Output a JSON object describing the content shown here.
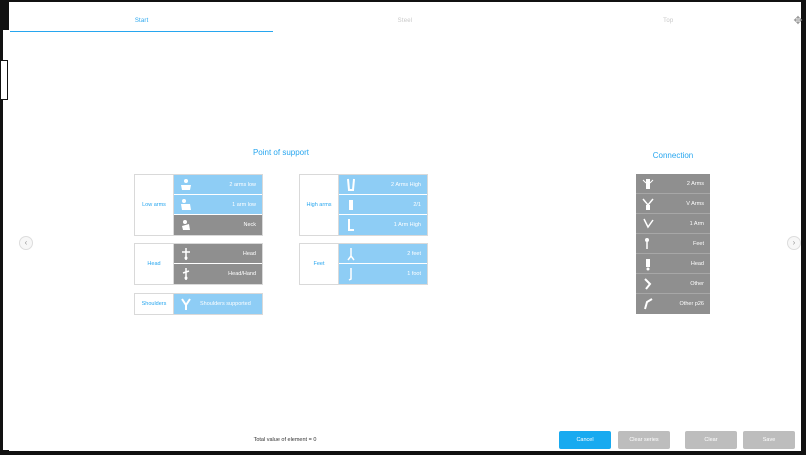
{
  "tabs": [
    {
      "label": "Start",
      "active": true
    },
    {
      "label": "Steel",
      "active": false
    },
    {
      "label": "Top",
      "active": false
    }
  ],
  "point_of_support": {
    "title": "Point of support",
    "groups": {
      "low_arms": {
        "label": "Low arms",
        "items": [
          "2 arms low",
          "1 arm low",
          "Neck"
        ]
      },
      "head": {
        "label": "Head",
        "items": [
          "Head",
          "Head/Hand"
        ]
      },
      "shoulders": {
        "label": "Shoulders",
        "items": [
          "Shoulders supported"
        ]
      },
      "high_arms": {
        "label": "High arms",
        "items": [
          "2 Arms High",
          "2/1",
          "1 Arm High"
        ]
      },
      "feet": {
        "label": "Feet",
        "items": [
          "2 feet",
          "1 foot"
        ]
      }
    }
  },
  "connection": {
    "title": "Connection",
    "items": [
      "2 Arms",
      "V Arms",
      "1 Arm",
      "Feet",
      "Head",
      "Other",
      "Other p26"
    ]
  },
  "footer": {
    "total": "Total value of element = 0",
    "buttons": {
      "cancel": "Cancel",
      "clear_series": "Clear series",
      "clear": "Clear",
      "save": "Save"
    }
  },
  "colors": {
    "accent": "#27a6ef",
    "selected_row": "#8ecdf5",
    "unselected_row": "#8f8f8f",
    "primary_button": "#18aaf0",
    "disabled_button": "#bdbdbd"
  },
  "icons": {
    "move": "move-arrows-icon",
    "prev": "chevron-left-icon",
    "next": "chevron-right-icon"
  }
}
